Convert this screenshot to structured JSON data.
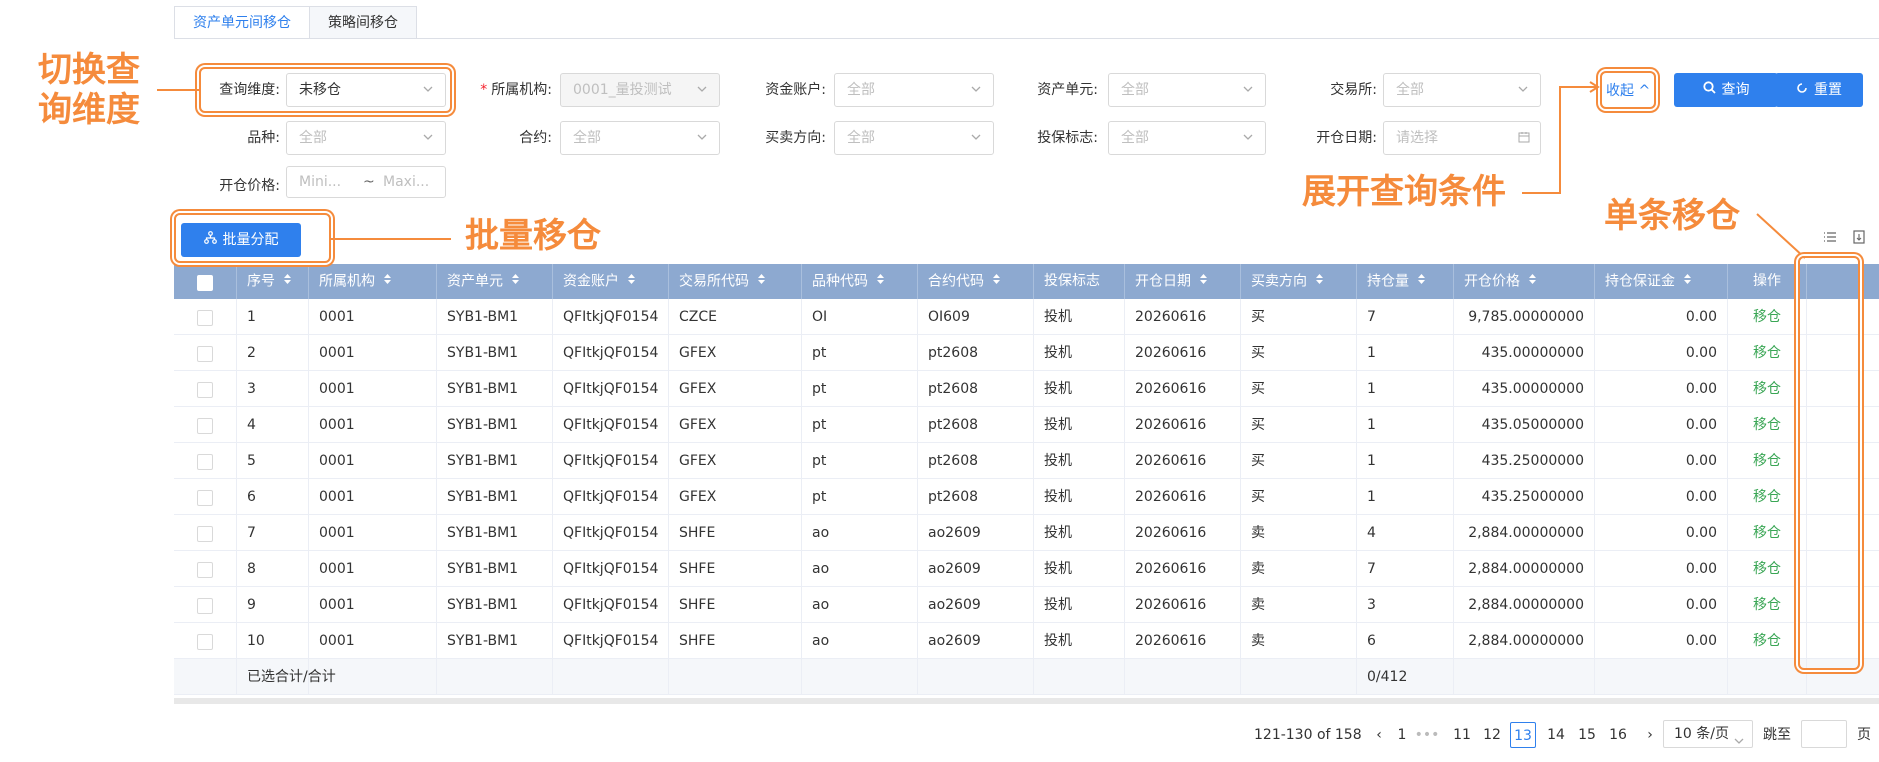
{
  "tabs": [
    {
      "label": "资产单元间移仓",
      "active": true
    },
    {
      "label": "策略间移仓",
      "active": false
    }
  ],
  "filters": {
    "dimension": {
      "label": "查询维度:",
      "value": "未移仓"
    },
    "org": {
      "label": "所属机构:",
      "value": "0001_量投测试",
      "required": true
    },
    "fund_account": {
      "label": "资金账户:",
      "placeholder": "全部"
    },
    "asset_unit": {
      "label": "资产单元:",
      "placeholder": "全部"
    },
    "exchange": {
      "label": "交易所:",
      "placeholder": "全部"
    },
    "variety": {
      "label": "品种:",
      "placeholder": "全部"
    },
    "contract": {
      "label": "合约:",
      "placeholder": "全部"
    },
    "direction": {
      "label": "买卖方向:",
      "placeholder": "全部"
    },
    "hedge": {
      "label": "投保标志:",
      "placeholder": "全部"
    },
    "open_date": {
      "label": "开仓日期:",
      "placeholder": "请选择"
    },
    "open_price": {
      "label": "开仓价格:",
      "min_placeholder": "Mini...",
      "max_placeholder": "Maxi...",
      "separator": "~"
    }
  },
  "actions": {
    "collapse": "收起",
    "query": "查询",
    "reset": "重置",
    "batch": "批量分配"
  },
  "annotations": {
    "switch_dimension": "切换查\n询维度",
    "expand_conditions": "展开查询条件",
    "batch_move": "批量移仓",
    "single_move": "单条移仓"
  },
  "table": {
    "columns": [
      "序号",
      "所属机构",
      "资产单元",
      "资金账户",
      "交易所代码",
      "品种代码",
      "合约代码",
      "投保标志",
      "开仓日期",
      "买卖方向",
      "持仓量",
      "开仓价格",
      "持仓保证金",
      "操作"
    ],
    "rows": [
      [
        "1",
        "0001",
        "SYB1-BM1",
        "QFItkjQF0154",
        "CZCE",
        "OI",
        "OI609",
        "投机",
        "20260616",
        "买",
        "7",
        "9,785.00000000",
        "0.00",
        "移仓"
      ],
      [
        "2",
        "0001",
        "SYB1-BM1",
        "QFItkjQF0154",
        "GFEX",
        "pt",
        "pt2608",
        "投机",
        "20260616",
        "买",
        "1",
        "435.00000000",
        "0.00",
        "移仓"
      ],
      [
        "3",
        "0001",
        "SYB1-BM1",
        "QFItkjQF0154",
        "GFEX",
        "pt",
        "pt2608",
        "投机",
        "20260616",
        "买",
        "1",
        "435.00000000",
        "0.00",
        "移仓"
      ],
      [
        "4",
        "0001",
        "SYB1-BM1",
        "QFItkjQF0154",
        "GFEX",
        "pt",
        "pt2608",
        "投机",
        "20260616",
        "买",
        "1",
        "435.05000000",
        "0.00",
        "移仓"
      ],
      [
        "5",
        "0001",
        "SYB1-BM1",
        "QFItkjQF0154",
        "GFEX",
        "pt",
        "pt2608",
        "投机",
        "20260616",
        "买",
        "1",
        "435.25000000",
        "0.00",
        "移仓"
      ],
      [
        "6",
        "0001",
        "SYB1-BM1",
        "QFItkjQF0154",
        "GFEX",
        "pt",
        "pt2608",
        "投机",
        "20260616",
        "买",
        "1",
        "435.25000000",
        "0.00",
        "移仓"
      ],
      [
        "7",
        "0001",
        "SYB1-BM1",
        "QFItkjQF0154",
        "SHFE",
        "ao",
        "ao2609",
        "投机",
        "20260616",
        "卖",
        "4",
        "2,884.00000000",
        "0.00",
        "移仓"
      ],
      [
        "8",
        "0001",
        "SYB1-BM1",
        "QFItkjQF0154",
        "SHFE",
        "ao",
        "ao2609",
        "投机",
        "20260616",
        "卖",
        "7",
        "2,884.00000000",
        "0.00",
        "移仓"
      ],
      [
        "9",
        "0001",
        "SYB1-BM1",
        "QFItkjQF0154",
        "SHFE",
        "ao",
        "ao2609",
        "投机",
        "20260616",
        "卖",
        "3",
        "2,884.00000000",
        "0.00",
        "移仓"
      ],
      [
        "10",
        "0001",
        "SYB1-BM1",
        "QFItkjQF0154",
        "SHFE",
        "ao",
        "ao2609",
        "投机",
        "20260616",
        "卖",
        "6",
        "2,884.00000000",
        "0.00",
        "移仓"
      ]
    ],
    "summary": {
      "label": "已选合计/合计",
      "position": "0/412"
    }
  },
  "pagination": {
    "range": "121-130 of 158",
    "first": "1",
    "ellipsis": "•••",
    "pages": [
      "11",
      "12",
      "13",
      "14",
      "15",
      "16"
    ],
    "current": "13",
    "page_size": "10 条/页",
    "jump_label": "跳至",
    "page_suffix": "页"
  },
  "colors": {
    "primary": "#2f80ed",
    "header": "#8da9d0",
    "annotation": "#f58b3c",
    "action": "#3aa655"
  }
}
